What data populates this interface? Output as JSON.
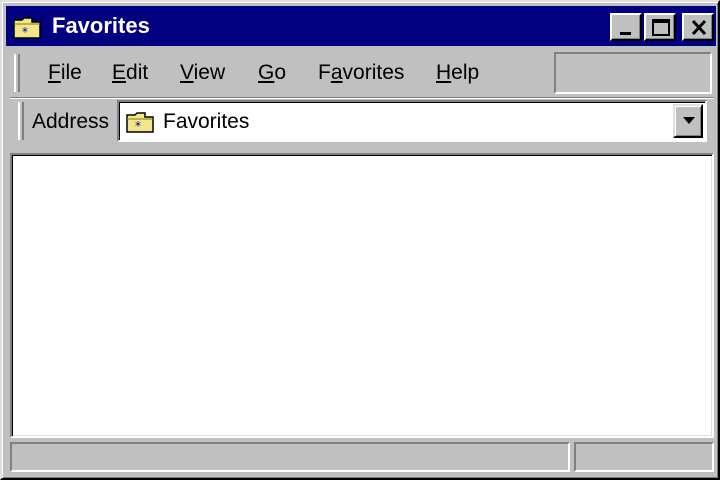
{
  "window": {
    "title": "Favorites",
    "icon": "folder-favorites-icon"
  },
  "title_buttons": {
    "minimize": "minimize-icon",
    "maximize": "maximize-icon",
    "close": "close-icon"
  },
  "menu": {
    "items": [
      {
        "label": "File",
        "hotkey": "F",
        "rest": "ile"
      },
      {
        "label": "Edit",
        "hotkey": "E",
        "rest": "dit"
      },
      {
        "label": "View",
        "hotkey": "V",
        "rest": "iew"
      },
      {
        "label": "Go",
        "hotkey": "G",
        "rest": "o"
      },
      {
        "label": "Favorites",
        "pre": "F",
        "hotkey": "a",
        "rest": "vorites"
      },
      {
        "label": "Help",
        "hotkey": "H",
        "rest": "elp"
      }
    ]
  },
  "address": {
    "label": "Address",
    "value": "Favorites",
    "icon": "folder-favorites-icon"
  },
  "colors": {
    "titlebar": "#000080",
    "chrome": "#c0c0c0",
    "folder": "#f2e68c"
  }
}
